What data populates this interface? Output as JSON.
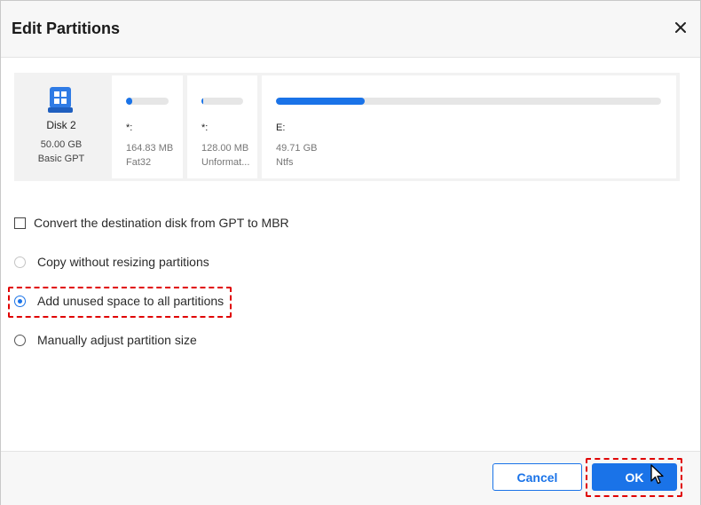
{
  "dialog": {
    "title": "Edit Partitions"
  },
  "disk": {
    "name": "Disk 2",
    "size": "50.00 GB",
    "type": "Basic GPT",
    "icon": "disk-windows-icon"
  },
  "partitions": [
    {
      "letter": "*:",
      "size": "164.83 MB",
      "fs": "Fat32",
      "usage_fraction": 0.15
    },
    {
      "letter": "*:",
      "size": "128.00 MB",
      "fs": "Unformat...",
      "usage_fraction": 0.05
    },
    {
      "letter": "E:",
      "size": "49.71 GB",
      "fs": "Ntfs",
      "usage_fraction": 0.23
    }
  ],
  "options": {
    "convert_label": "Convert the destination disk from GPT to MBR",
    "convert_checked": false,
    "copy_label": "Copy without resizing partitions",
    "add_label": "Add unused space to all partitions",
    "manual_label": "Manually adjust partition size",
    "selected": "add"
  },
  "buttons": {
    "cancel": "Cancel",
    "ok": "OK"
  },
  "colors": {
    "accent": "#1a73e8",
    "highlight": "#e00000"
  }
}
